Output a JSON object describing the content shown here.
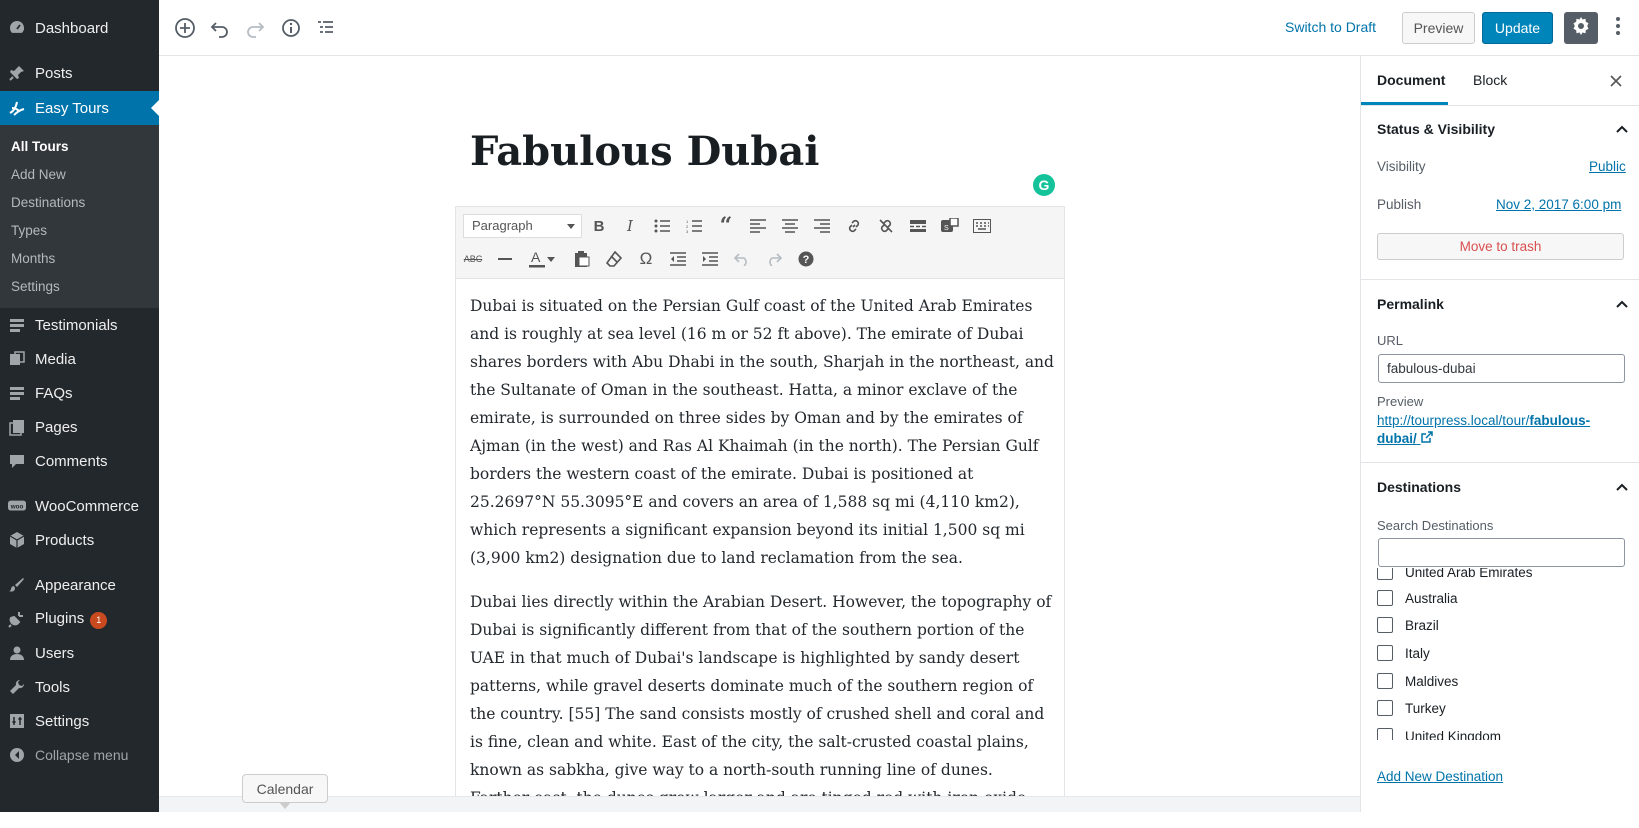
{
  "sidebar": {
    "dashboard": "Dashboard",
    "posts": "Posts",
    "easy_tours": "Easy Tours",
    "submenu": [
      "All Tours",
      "Add New",
      "Destinations",
      "Types",
      "Months",
      "Settings"
    ],
    "testimonials": "Testimonials",
    "media": "Media",
    "faqs": "FAQs",
    "pages": "Pages",
    "comments": "Comments",
    "woocommerce": "WooCommerce",
    "products": "Products",
    "appearance": "Appearance",
    "plugins": "Plugins",
    "plugins_badge": "1",
    "users": "Users",
    "tools": "Tools",
    "settings": "Settings",
    "collapse": "Collapse menu"
  },
  "topbar": {
    "switch_draft": "Switch to Draft",
    "preview": "Preview",
    "update": "Update"
  },
  "editor": {
    "title": "Fabulous Dubai",
    "format_select": "Paragraph",
    "paragraphs": [
      "Dubai is situated on the Persian Gulf coast of the United Arab Emirates and is roughly at sea level (16 m or 52 ft above). The emirate of Dubai shares borders with Abu Dhabi in the south, Sharjah in the northeast, and the Sultanate of Oman in the southeast. Hatta, a minor exclave of the emirate, is surrounded on three sides by Oman and by the emirates of Ajman (in the west) and Ras Al Khaimah (in the north). The Persian Gulf borders the western coast of the emirate. Dubai is positioned at 25.2697°N 55.3095°E and covers an area of 1,588 sq mi (4,110 km2), which represents a significant expansion beyond its initial 1,500 sq mi (3,900 km2) designation due to land reclamation from the sea.",
      "Dubai lies directly within the Arabian Desert. However, the topography of Dubai is significantly different from that of the southern portion of the UAE in that much of Dubai's landscape is highlighted by sandy desert patterns, while gravel deserts dominate much of the southern region of the country. [55] The sand consists mostly of crushed shell and coral and is fine, clean and white. East of the city, the salt-crusted coastal plains, known as sabkha, give way to a north-south running line of dunes. Farther east, the dunes grow larger and are tinged red with iron oxide."
    ],
    "tooltip": "Calendar"
  },
  "panel": {
    "tab_document": "Document",
    "tab_block": "Block",
    "status_title": "Status & Visibility",
    "visibility_label": "Visibility",
    "visibility_value": "Public",
    "publish_label": "Publish",
    "publish_value": "Nov 2, 2017 6:00 pm",
    "trash": "Move to trash",
    "permalink_title": "Permalink",
    "url_label": "URL",
    "url_value": "fabulous-dubai",
    "preview_label": "Preview",
    "preview_link_prefix": "http://tourpress.local/tour/",
    "preview_link_bold": "fabulous-",
    "preview_link_line2": "dubai/",
    "destinations_title": "Destinations",
    "search_label": "Search Destinations",
    "search_value": "",
    "destinations": [
      "United Arab Emirates",
      "Australia",
      "Brazil",
      "Italy",
      "Maldives",
      "Turkey",
      "United Kingdom"
    ],
    "add_new": "Add New Destination"
  },
  "colors": {
    "sidebar_bg": "#23282d",
    "active_bg": "#0073aa",
    "update_btn": "#0085ba",
    "link": "#0073aa",
    "grammarly": "#15c39a"
  }
}
